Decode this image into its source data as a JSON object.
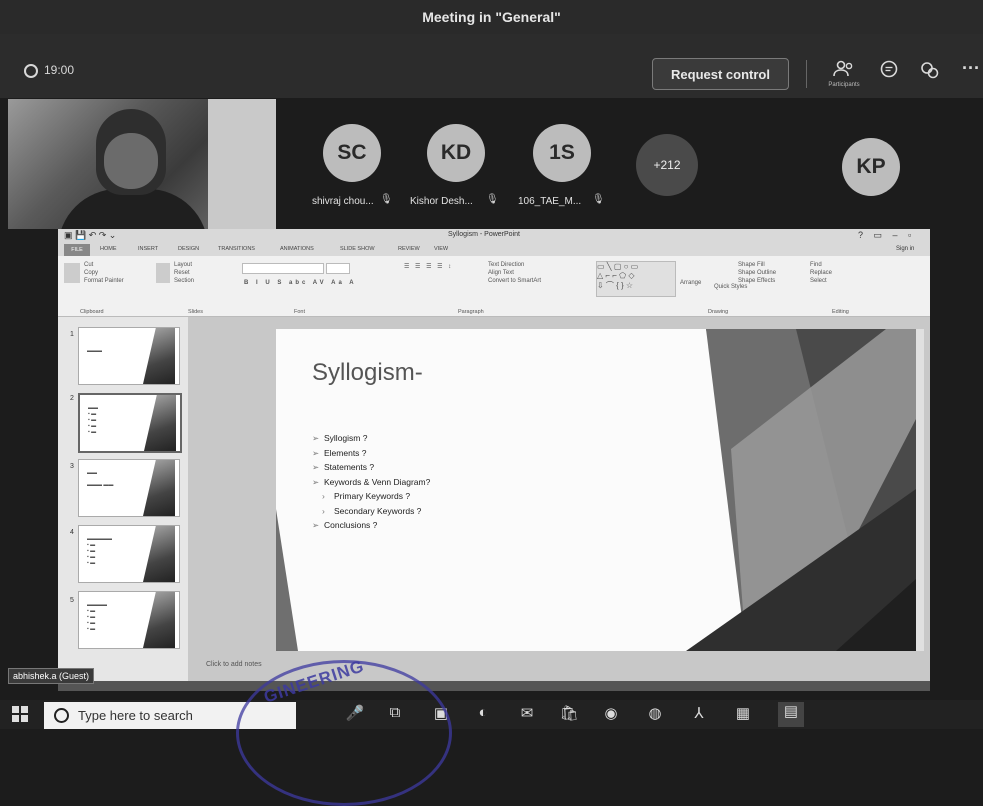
{
  "meeting": {
    "title": "Meeting in \"General\"",
    "timer": "19:00",
    "request_control_label": "Request control",
    "participants_label": "Participants"
  },
  "participants": [
    {
      "initials": "SC",
      "name": "shivraj chou..."
    },
    {
      "initials": "KD",
      "name": "Kishor Desh..."
    },
    {
      "initials": "1S",
      "name": "106_TAE_M..."
    }
  ],
  "more_participants": "+212",
  "extra_participant": "KP",
  "guest_label": "abhishek.a (Guest)",
  "ppt": {
    "window_title": "Syllogism - PowerPoint",
    "tabs": [
      "FILE",
      "HOME",
      "INSERT",
      "DESIGN",
      "TRANSITIONS",
      "ANIMATIONS",
      "SLIDE SHOW",
      "REVIEW",
      "VIEW"
    ],
    "sign_in": "Sign in",
    "ribbon_groups": [
      "Clipboard",
      "Slides",
      "Font",
      "Paragraph",
      "Drawing",
      "Editing"
    ],
    "clipboard_items": [
      "Cut",
      "Copy",
      "Format Painter"
    ],
    "slides_items": [
      "Layout",
      "Reset",
      "Section"
    ],
    "paragraph_items": [
      "Text Direction",
      "Align Text",
      "Convert to SmartArt"
    ],
    "drawing_items": [
      "Arrange",
      "Quick Styles",
      "Shape Fill",
      "Shape Outline",
      "Shape Effects"
    ],
    "editing_items": [
      "Find",
      "Replace",
      "Select"
    ],
    "notes_placeholder": "Click to add notes",
    "thumbnail_numbers": [
      "1",
      "2",
      "3",
      "4",
      "5"
    ]
  },
  "slide": {
    "title": "Syllogism-",
    "bullets": [
      {
        "text": "Syllogism ?",
        "sub": false
      },
      {
        "text": "Elements ?",
        "sub": false
      },
      {
        "text": "Statements ?",
        "sub": false
      },
      {
        "text": "Keywords & Venn Diagram?",
        "sub": false
      },
      {
        "text": "Primary Keywords ?",
        "sub": true
      },
      {
        "text": "Secondary Keywords ?",
        "sub": true
      },
      {
        "text": "Conclusions ?",
        "sub": false
      }
    ]
  },
  "taskbar": {
    "search_placeholder": "Type here to search"
  },
  "stamp_text": "GINEERING"
}
